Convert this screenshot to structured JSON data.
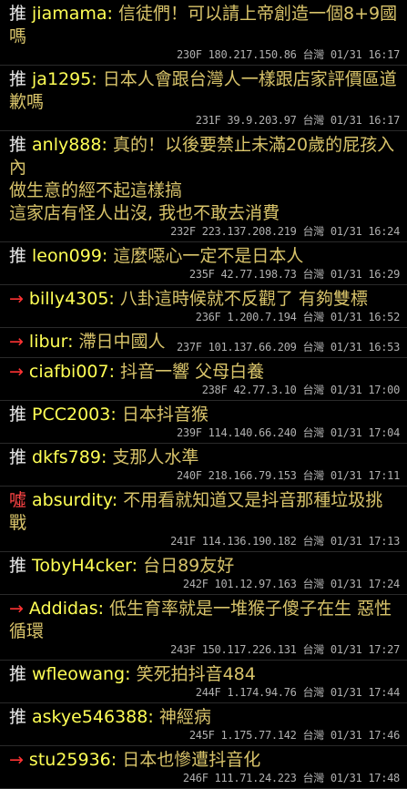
{
  "pushes": [
    {
      "tag": "推",
      "user": "jiamama",
      "content": "信徒們！可以請上帝創造一個8+9國嗎",
      "meta": "230F 180.217.150.86 台灣 01/31 16:17",
      "extra": []
    },
    {
      "tag": "推",
      "user": "ja1295",
      "content": "日本人會跟台灣人一樣跟店家評價區道歉嗎",
      "meta": "231F 39.9.203.97 台灣 01/31 16:17",
      "extra": []
    },
    {
      "tag": "推",
      "user": "anly888",
      "content": "真的！以後要禁止未滿20歲的屁孩入內",
      "meta": "232F 223.137.208.219 台灣 01/31 16:24",
      "extra": [
        "做生意的經不起這樣搞",
        "這家店有怪人出沒, 我也不敢去消費"
      ]
    },
    {
      "tag": "推",
      "user": "leon099",
      "content": "這麼噁心一定不是日本人",
      "meta": "235F 42.77.198.73 台灣 01/31 16:29",
      "extra": []
    },
    {
      "tag": "→",
      "user": "billy4305",
      "content": "八卦這時候就不反觀了 有夠雙標",
      "meta": "236F 1.200.7.194 台灣 01/31 16:52",
      "extra": []
    },
    {
      "tag": "→",
      "user": "libur",
      "content": "滯日中國人",
      "meta": "237F 101.137.66.209 台灣 01/31 16:53",
      "extra": []
    },
    {
      "tag": "→",
      "user": "ciafbi007",
      "content": "抖音一響 父母白養",
      "meta": "238F 42.77.3.10 台灣 01/31 17:00",
      "extra": []
    },
    {
      "tag": "推",
      "user": "PCC2003",
      "content": "日本抖音猴",
      "meta": "239F 114.140.66.240 台灣 01/31 17:04",
      "extra": []
    },
    {
      "tag": "推",
      "user": "dkfs789",
      "content": "支那人水準",
      "meta": "240F 218.166.79.153 台灣 01/31 17:11",
      "extra": []
    },
    {
      "tag": "噓",
      "user": "absurdity",
      "content": "不用看就知道又是抖音那種垃圾挑戰",
      "meta": "241F 114.136.190.182 台灣 01/31 17:13",
      "extra": []
    },
    {
      "tag": "推",
      "user": "TobyH4cker",
      "content": "台日89友好",
      "meta": "242F 101.12.97.163 台灣 01/31 17:24",
      "extra": []
    },
    {
      "tag": "→",
      "user": "Addidas",
      "content": "低生育率就是一堆猴子傻子在生 惡性循環",
      "meta": "243F 150.117.226.131 台灣 01/31 17:27",
      "extra": []
    },
    {
      "tag": "推",
      "user": "wfleowang",
      "content": "笑死拍抖音484",
      "meta": "244F 1.174.94.76 台灣 01/31 17:44",
      "extra": []
    },
    {
      "tag": "推",
      "user": "askye546388",
      "content": "神經病",
      "meta": "245F 1.175.77.142 台灣 01/31 17:46",
      "extra": []
    },
    {
      "tag": "→",
      "user": "stu25936",
      "content": "日本也慘遭抖音化",
      "meta": "246F 111.71.24.223 台灣 01/31 17:48",
      "extra": []
    }
  ]
}
